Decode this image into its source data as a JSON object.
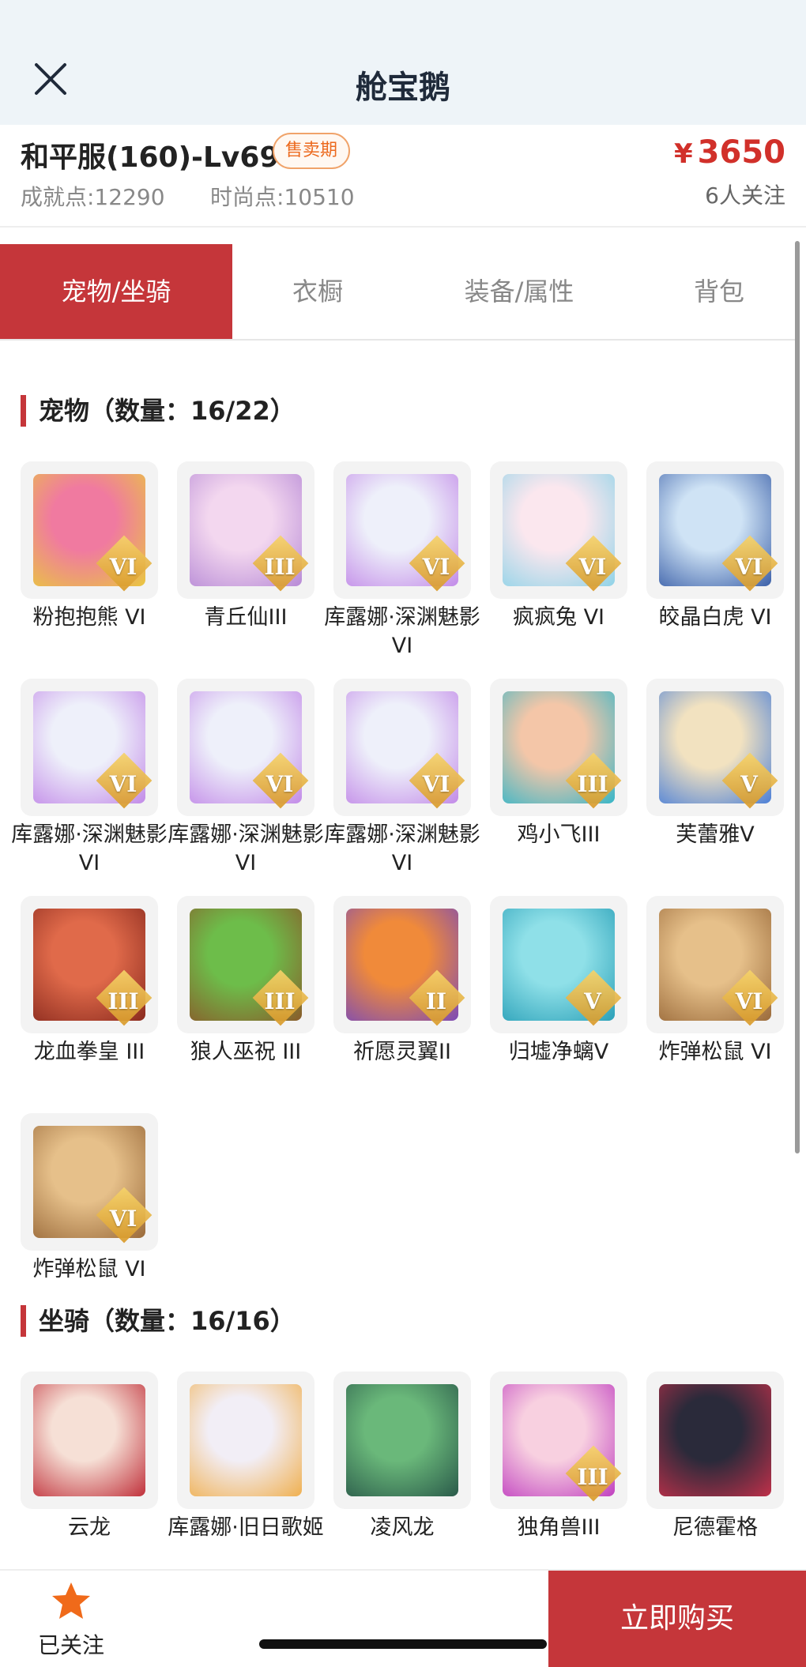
{
  "header": {
    "title": "舱宝鹅"
  },
  "summary": {
    "server": "和平服(160)-Lv69",
    "badge": "售卖期",
    "achievement": "成就点:12290",
    "fashion": "时尚点:10510",
    "price_symbol": "¥",
    "price": "3650",
    "followers": "6人关注"
  },
  "tabs": [
    {
      "label": "宠物/坐骑",
      "active": true
    },
    {
      "label": "衣橱",
      "active": false
    },
    {
      "label": "装备/属性",
      "active": false
    },
    {
      "label": "背包",
      "active": false
    }
  ],
  "pets": {
    "title": "宠物（数量：16/22）",
    "items": [
      {
        "name": "粉抱抱熊 VI",
        "tier": "VI",
        "icon": "pink-bear-icon",
        "colors": [
          "#f07aa0",
          "#e9c73f"
        ]
      },
      {
        "name": "青丘仙III",
        "tier": "III",
        "icon": "fox-fairy-icon",
        "colors": [
          "#f3d7ef",
          "#b78ad6"
        ]
      },
      {
        "name": "库露娜·深渊魅影VI",
        "tier": "VI",
        "icon": "kuluna-icon",
        "colors": [
          "#eef0fa",
          "#c28ae8"
        ]
      },
      {
        "name": "疯疯兔 VI",
        "tier": "VI",
        "icon": "crazy-rabbit-icon",
        "colors": [
          "#fbe7ee",
          "#8fd3e8"
        ]
      },
      {
        "name": "皎晶白虎 VI",
        "tier": "VI",
        "icon": "white-tiger-icon",
        "colors": [
          "#cfe3f5",
          "#3a5fa8"
        ]
      },
      {
        "name": "库露娜·深渊魅影VI",
        "tier": "VI",
        "icon": "kuluna-icon",
        "colors": [
          "#eef0fa",
          "#c28ae8"
        ]
      },
      {
        "name": "库露娜·深渊魅影VI",
        "tier": "VI",
        "icon": "kuluna-icon",
        "colors": [
          "#eef0fa",
          "#c28ae8"
        ]
      },
      {
        "name": "库露娜·深渊魅影VI",
        "tier": "VI",
        "icon": "kuluna-icon",
        "colors": [
          "#eef0fa",
          "#c28ae8"
        ]
      },
      {
        "name": "鸡小飞III",
        "tier": "III",
        "icon": "chick-fighter-icon",
        "colors": [
          "#f4c6a8",
          "#35b6c8"
        ]
      },
      {
        "name": "芙蕾雅V",
        "tier": "V",
        "icon": "freya-icon",
        "colors": [
          "#f2e2c0",
          "#4a7fd8"
        ]
      },
      {
        "name": "龙血拳皇 III",
        "tier": "III",
        "icon": "dragon-boxer-icon",
        "colors": [
          "#e06a4a",
          "#8a2a1e"
        ]
      },
      {
        "name": "狼人巫祝 III",
        "tier": "III",
        "icon": "werewolf-shaman-icon",
        "colors": [
          "#6dbd4a",
          "#8a5a2a"
        ]
      },
      {
        "name": "祈愿灵翼II",
        "tier": "II",
        "icon": "wish-wing-icon",
        "colors": [
          "#f08a3a",
          "#7a4ab8"
        ]
      },
      {
        "name": "归墟净螭V",
        "tier": "V",
        "icon": "sea-dragon-icon",
        "colors": [
          "#8fe0e8",
          "#2aa0b8"
        ]
      },
      {
        "name": "炸弹松鼠 VI",
        "tier": "VI",
        "icon": "bomb-squirrel-icon",
        "colors": [
          "#e6c08a",
          "#9a6a3a"
        ]
      },
      {
        "name": "炸弹松鼠 VI",
        "tier": "VI",
        "icon": "bomb-squirrel-icon",
        "colors": [
          "#e6c08a",
          "#9a6a3a"
        ]
      }
    ]
  },
  "mounts": {
    "title": "坐骑（数量：16/16）",
    "items": [
      {
        "name": "云龙",
        "tier": "",
        "icon": "cloud-dragon-icon",
        "colors": [
          "#f6e0d6",
          "#c0303a"
        ]
      },
      {
        "name": "库露娜·旧日歌姬",
        "tier": "",
        "icon": "kuluna-singer-icon",
        "colors": [
          "#f2eef6",
          "#f0b050"
        ]
      },
      {
        "name": "凌风龙",
        "tier": "",
        "icon": "wind-dragon-icon",
        "colors": [
          "#6ab87a",
          "#2a5a4a"
        ]
      },
      {
        "name": "独角兽III",
        "tier": "III",
        "icon": "unicorn-icon",
        "colors": [
          "#f8d0e0",
          "#c040c0"
        ]
      },
      {
        "name": "尼德霍格",
        "tier": "",
        "icon": "nidhogg-icon",
        "colors": [
          "#2a2a3a",
          "#c0304a"
        ]
      }
    ]
  },
  "footer": {
    "follow_label": "已关注",
    "buy_label": "立即购买",
    "star_color": "#f06a1a"
  },
  "theme": {
    "accent": "#c5363a"
  }
}
